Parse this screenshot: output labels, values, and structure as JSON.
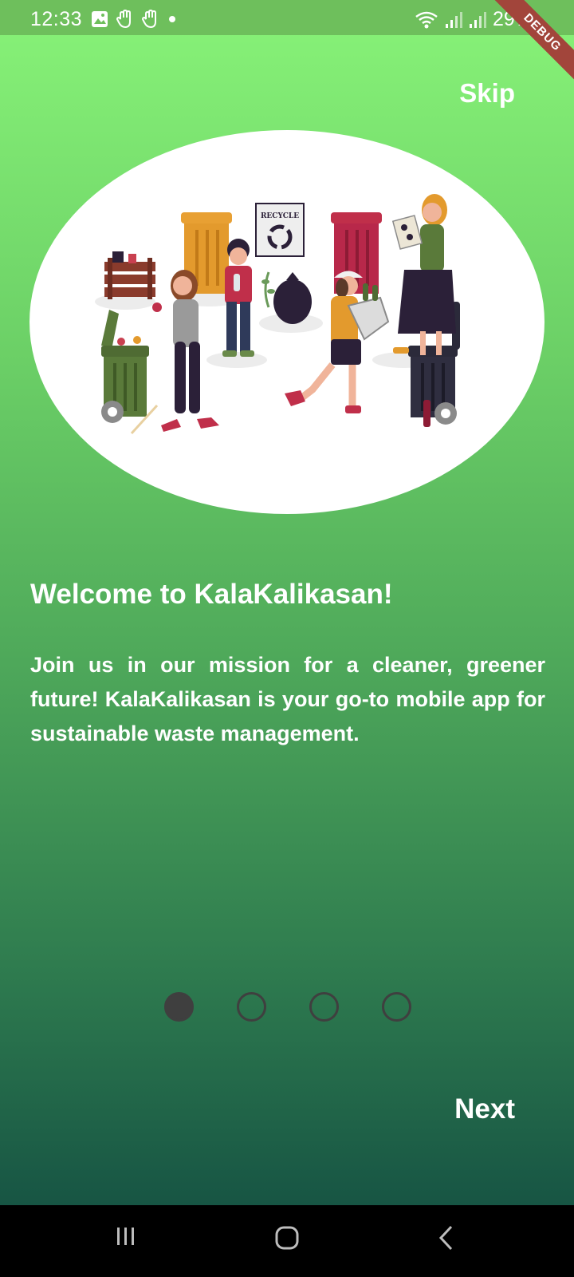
{
  "status_bar": {
    "time": "12:33",
    "battery": "29%",
    "debug_banner": "DEBUG"
  },
  "onboarding": {
    "skip_label": "Skip",
    "title": "Welcome to KalaKalikasan!",
    "description": "Join us in our mission for a cleaner, greener future! KalaKalikasan is your go-to mobile app for sustainable waste management.",
    "illustration_sign": "RECYCLE",
    "next_label": "Next",
    "page_indicator": {
      "current": 1,
      "total": 4
    }
  },
  "colors": {
    "gradient_top": "#88f378",
    "gradient_bottom": "#175544",
    "dot_color": "#3f3f3f",
    "debug_ribbon": "#a2453b"
  },
  "icons": {
    "nav_recents": "recents-icon",
    "nav_home": "home-icon",
    "nav_back": "back-icon"
  }
}
